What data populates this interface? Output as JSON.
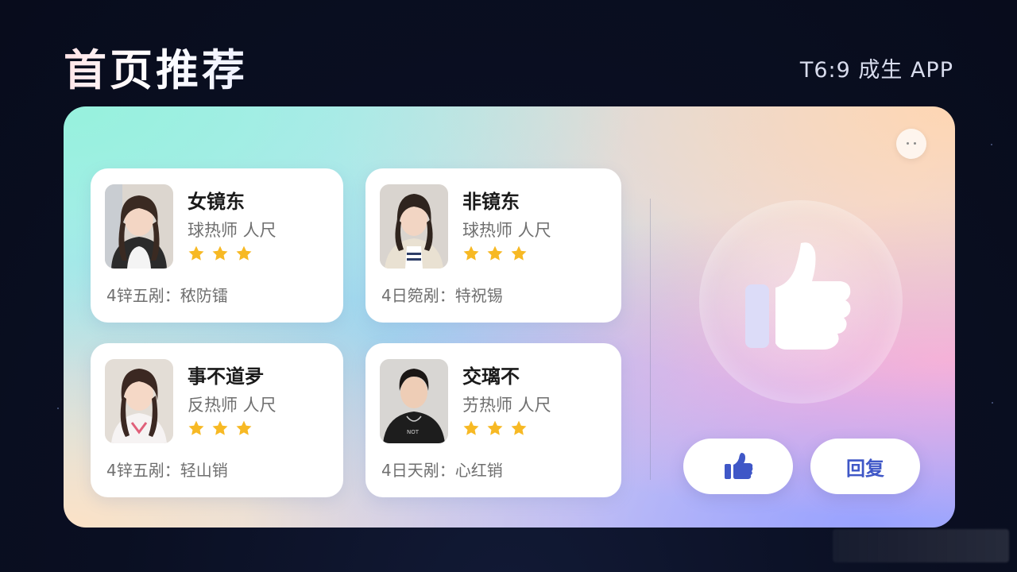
{
  "header": {
    "title": "首页推荐",
    "app_tag": "T6:9 成生 APP"
  },
  "cards": [
    {
      "name": "女镜东",
      "role": "球热师 人尺",
      "rating": 3,
      "info": "4锌五剐：秾防镭"
    },
    {
      "name": "非镜东",
      "role": "球热师 人尺",
      "rating": 3,
      "info": "4日箢剐：特祝锡"
    },
    {
      "name": "事不道夛",
      "role": "反热师 人尺",
      "rating": 3,
      "info": "4锌五剐：轻山销"
    },
    {
      "name": "交璃不",
      "role": "艻热师 人尺",
      "rating": 3,
      "info": "4日天剐：心红销"
    }
  ],
  "actions": {
    "reply_label": "回复"
  },
  "icons": {
    "large_like": "thumbs-up-icon",
    "like_button": "thumbs-up-icon",
    "star": "star-icon",
    "corner": "bubble-icon"
  },
  "colors": {
    "accent": "#3f57c7",
    "star": "#f7b924",
    "background": "#0b1024"
  }
}
